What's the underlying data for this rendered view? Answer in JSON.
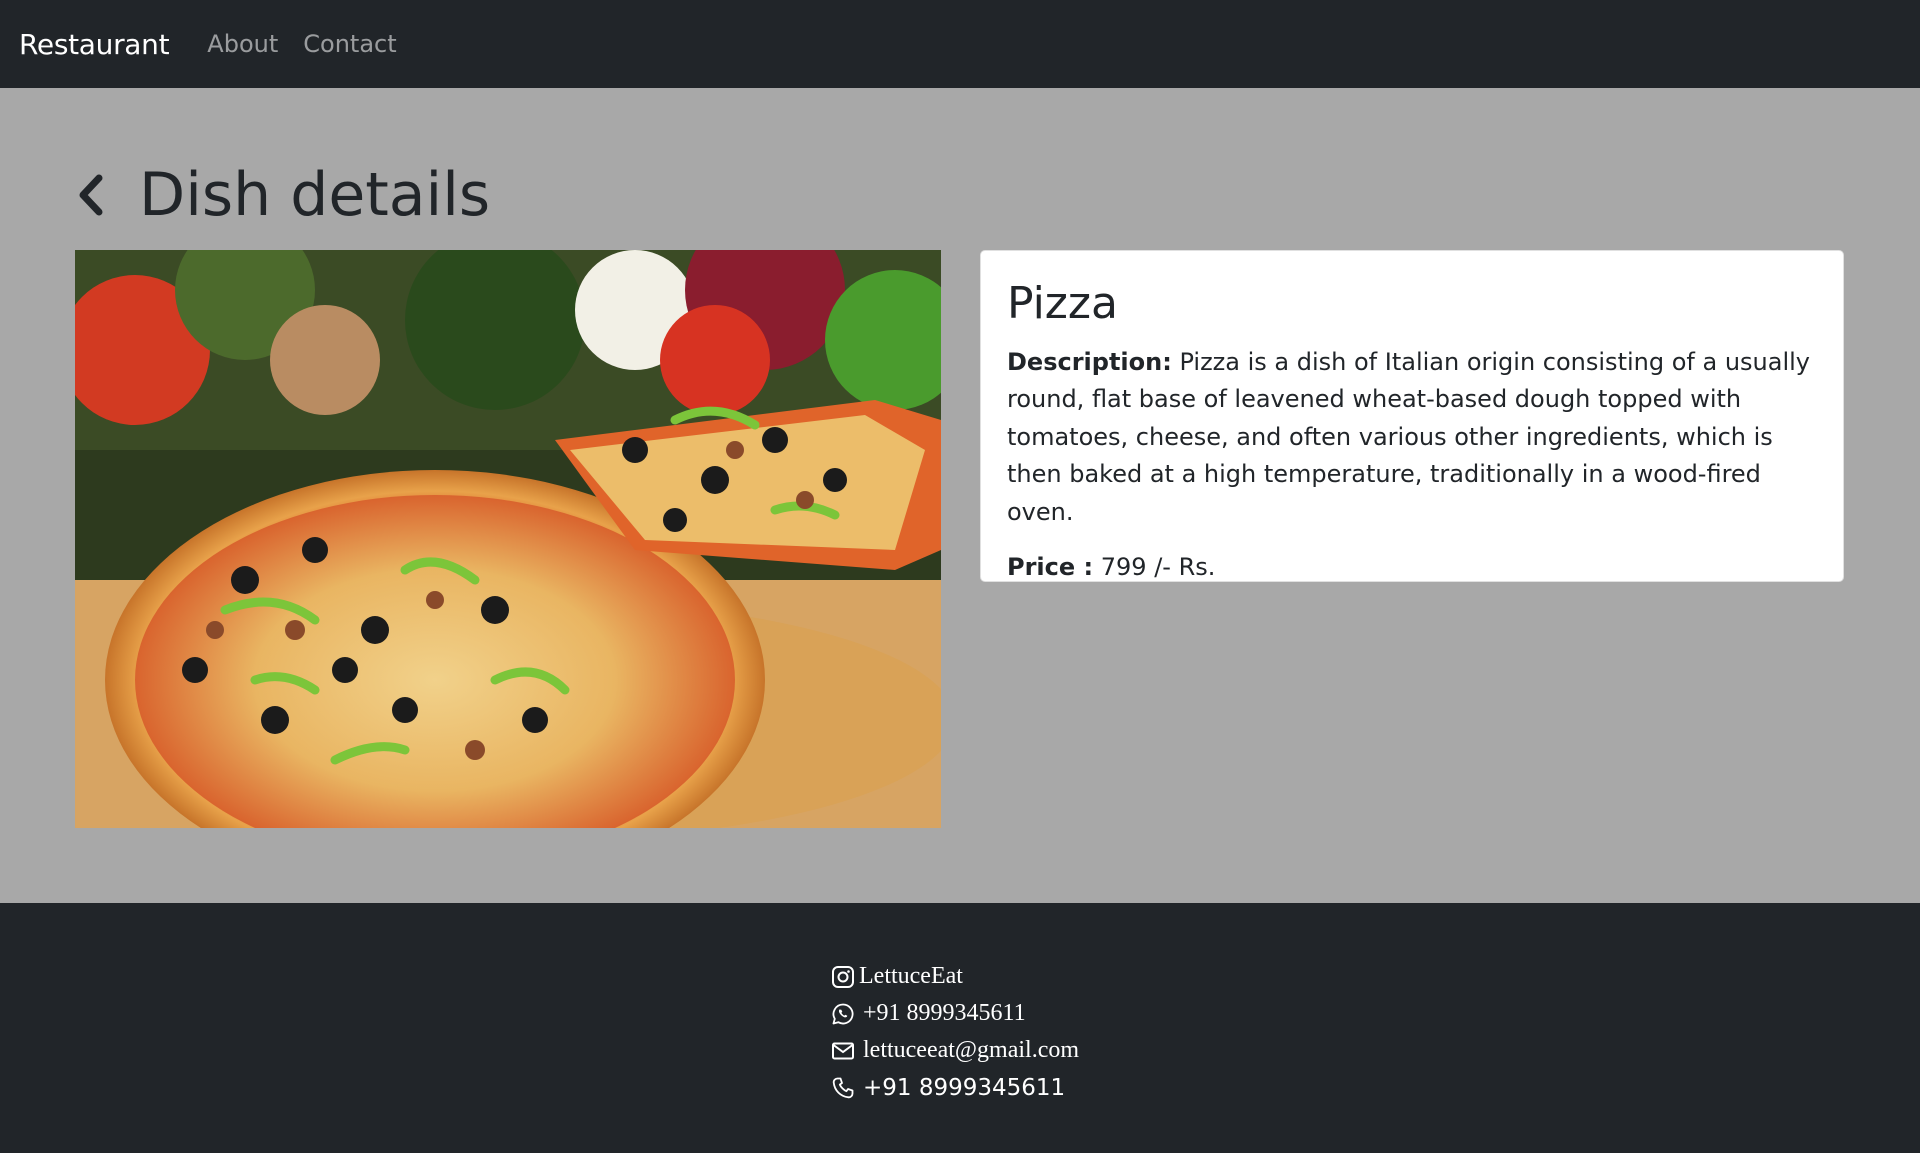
{
  "navbar": {
    "brand": "Restaurant",
    "links": [
      {
        "label": "About"
      },
      {
        "label": "Contact"
      }
    ]
  },
  "page": {
    "title": "Dish details",
    "back_icon": "chevron-left-icon"
  },
  "dish": {
    "image_alt_subject": "pizza",
    "name": "Pizza",
    "description_label": "Description:",
    "description": "Pizza is a dish of Italian origin consisting of a usually round, flat base of leavened wheat-based dough topped with tomatoes, cheese, and often various other ingredients, which is then baked at a high temperature, traditionally in a wood-fired oven.",
    "price_label": "Price :",
    "price": "799 /- Rs."
  },
  "footer": {
    "instagram": "LettuceEat",
    "whatsapp": "+91 8999345611",
    "email": "lettuceeat@gmail.com",
    "phone": "+91 8999345611"
  },
  "colors": {
    "navbar_bg": "#212529",
    "page_bg": "#a8a8a8",
    "card_bg": "#ffffff",
    "footer_bg": "#212529"
  }
}
